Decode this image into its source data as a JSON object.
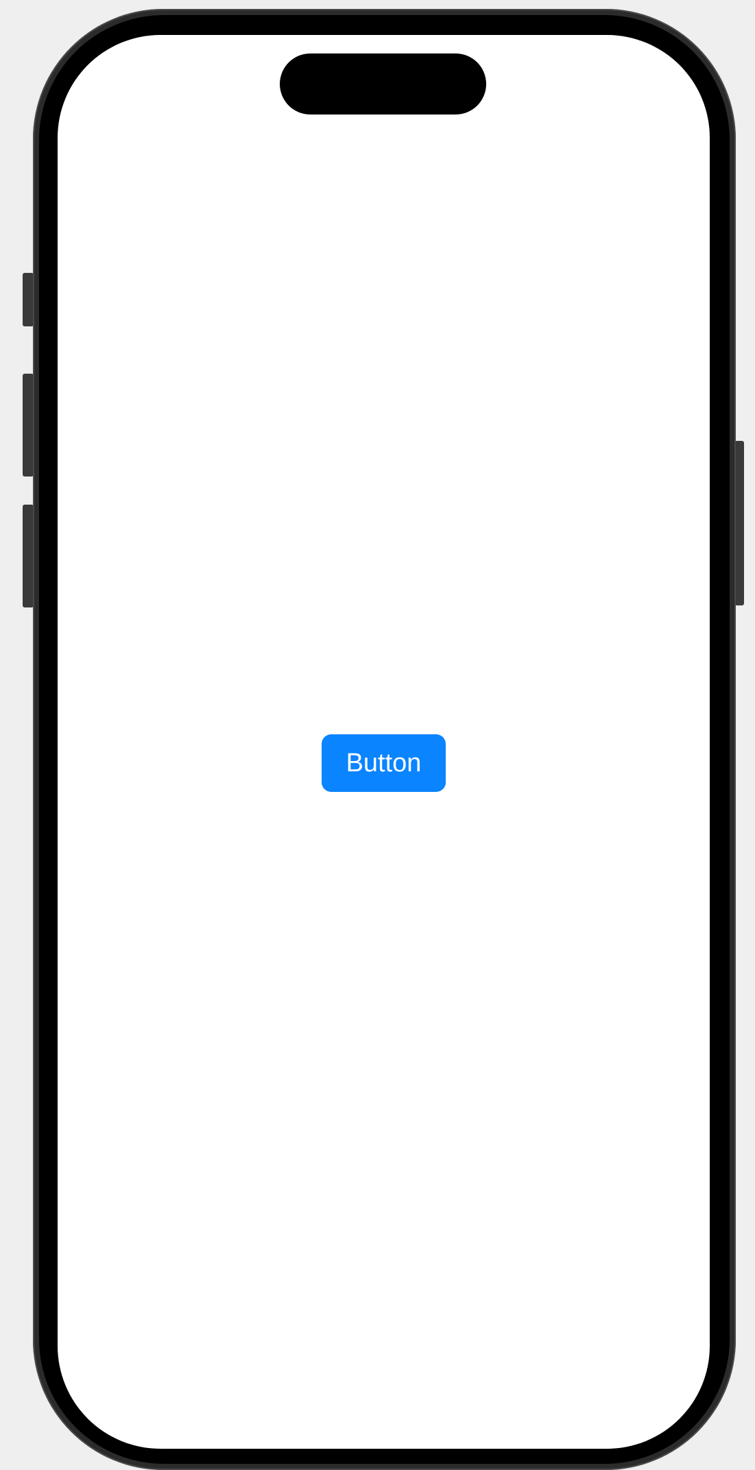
{
  "screen": {
    "background_color": "#ffffff",
    "button": {
      "label": "Button",
      "color": "#0a84ff",
      "text_color": "#ffffff"
    }
  },
  "device": {
    "frame_color": "#2b2b2b",
    "bezel_color": "#000000",
    "backdrop_color": "#efefef"
  }
}
